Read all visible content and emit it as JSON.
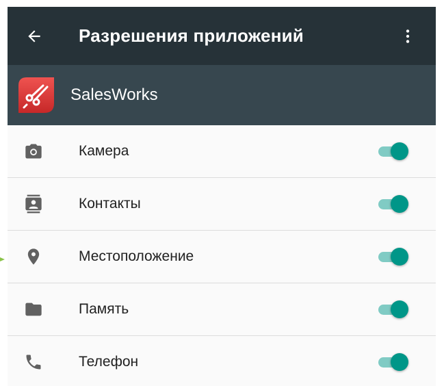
{
  "toolbar": {
    "back_icon": "arrow-back-icon",
    "title": "Разрешения приложений",
    "menu_icon": "more-vert-icon",
    "background": "#263238"
  },
  "app": {
    "name": "SalesWorks",
    "logo_icon": "salesworks-logo",
    "logo_color": "#d32f2f",
    "header_background": "#37474f"
  },
  "permissions": [
    {
      "label": "Камера",
      "icon": "camera-icon",
      "enabled": true
    },
    {
      "label": "Контакты",
      "icon": "contacts-icon",
      "enabled": true
    },
    {
      "label": "Местоположение",
      "icon": "location-icon",
      "enabled": true
    },
    {
      "label": "Память",
      "icon": "folder-icon",
      "enabled": true
    },
    {
      "label": "Телефон",
      "icon": "phone-icon",
      "enabled": true
    }
  ],
  "colors": {
    "switch_thumb": "#009688",
    "switch_track": "#80cbc4",
    "icon_gray": "#616161"
  }
}
